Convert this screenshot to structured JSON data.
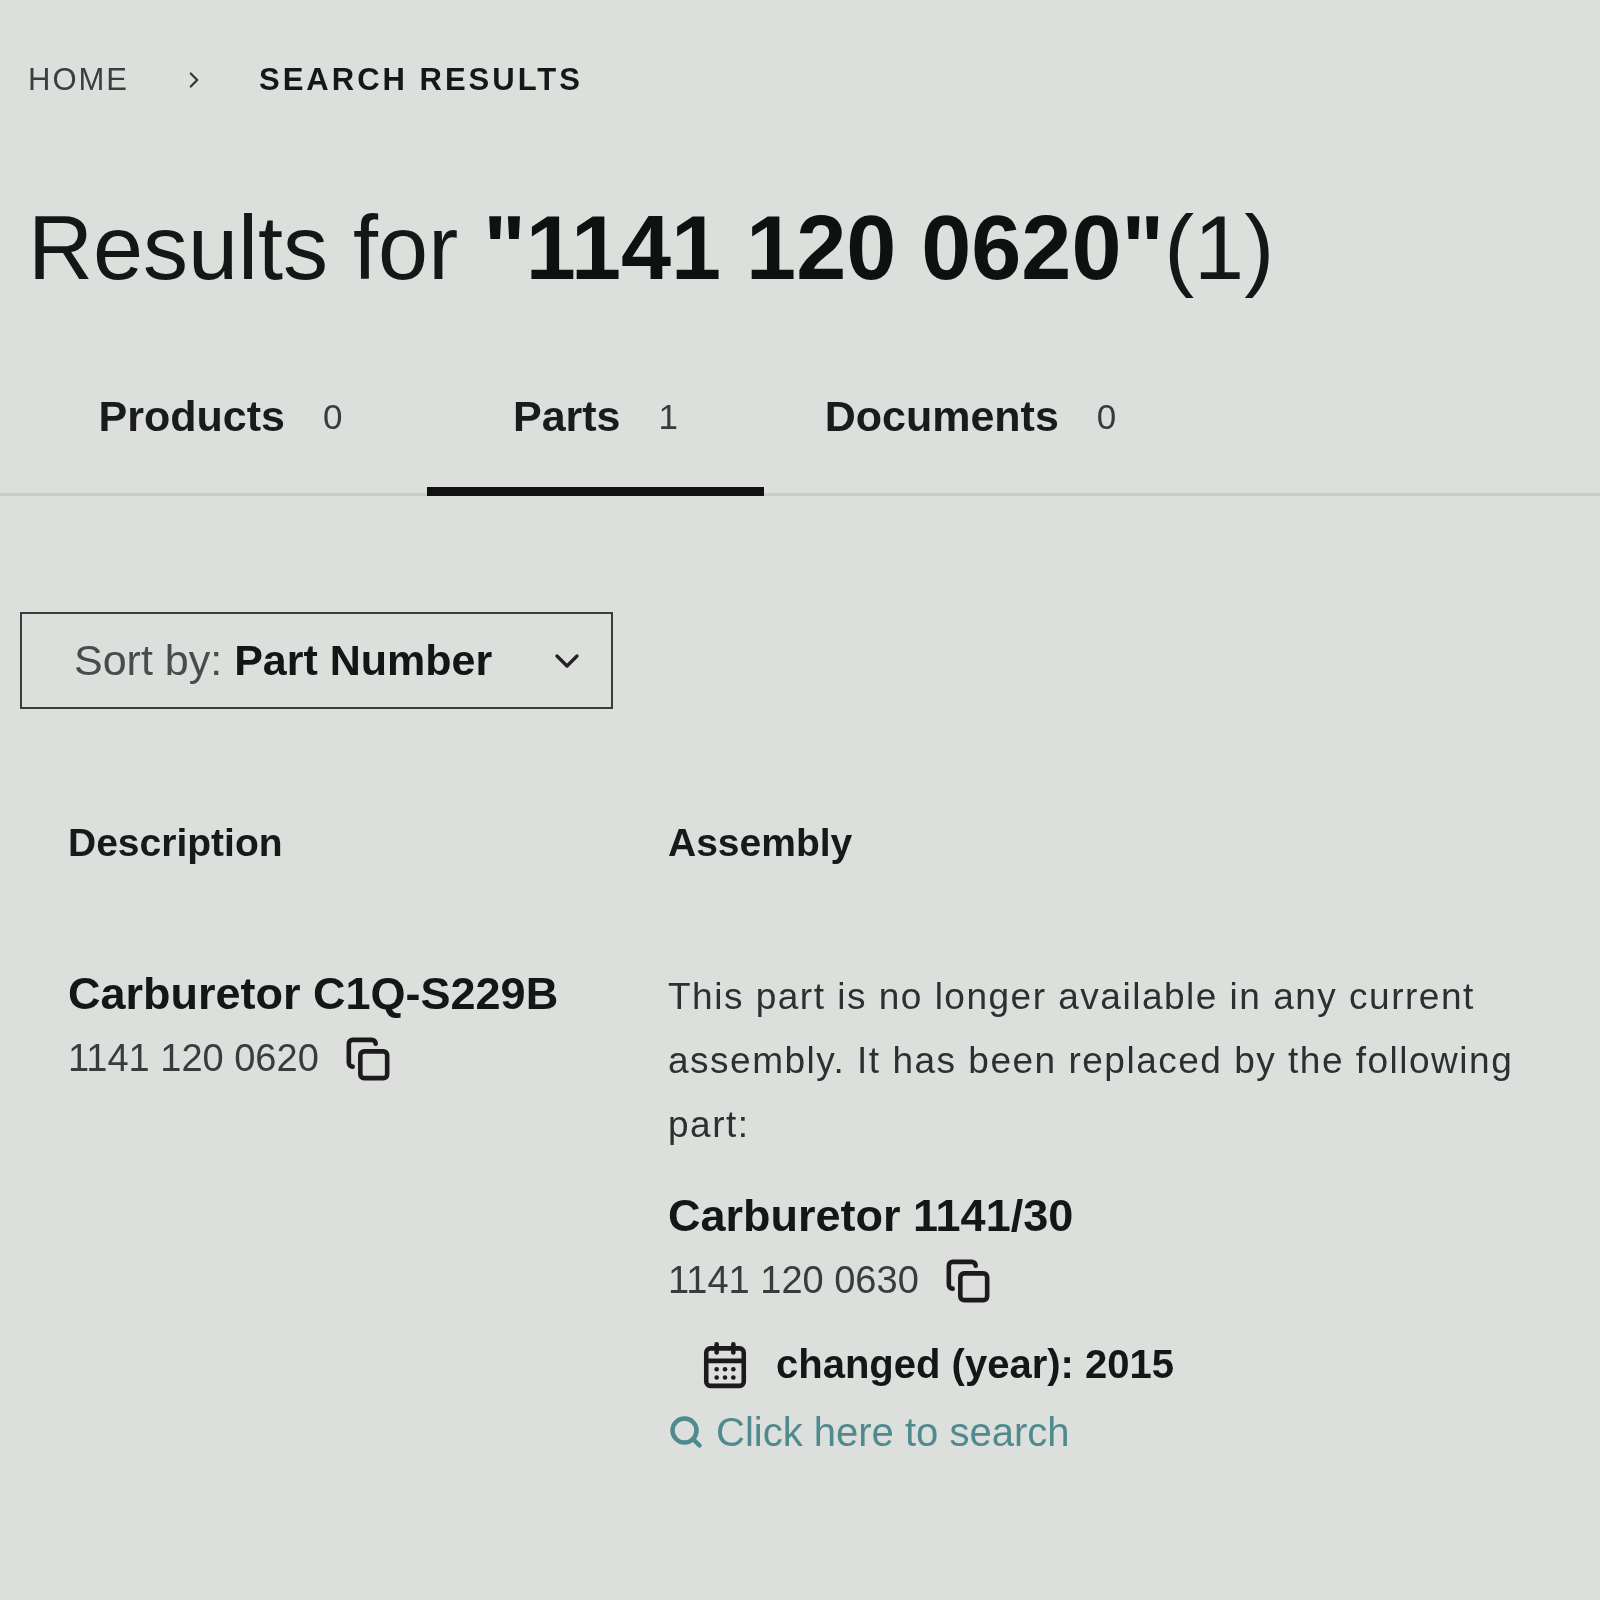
{
  "breadcrumb": [
    {
      "label": "HOME",
      "current": false
    },
    {
      "label": "SEARCH RESULTS",
      "current": true
    }
  ],
  "title": "Results for **\"1141 120 0620\"**(1)",
  "tabs": [
    {
      "label": "Products",
      "count": "0",
      "selected": false
    },
    {
      "label": "Parts",
      "count": "1",
      "selected": true
    },
    {
      "label": "Documents",
      "count": "0",
      "selected": false
    }
  ],
  "sort": {
    "label": "Sort by:",
    "value": "Part Number"
  },
  "table": {
    "columns": [
      "Description",
      "Assembly"
    ],
    "rows": [
      {
        "description": {
          "name": "Carburetor C1Q-S229B",
          "part_number": "1141 120 0620"
        },
        "assembly": {
          "message": "This part is no longer available in any current assembly. It has been replaced by the following part:",
          "replacement": {
            "name": "Carburetor 1141/30",
            "part_number": "1141 120 0630"
          },
          "changed": "changed (year): 2015",
          "search_link": "Click here to search"
        }
      }
    ]
  }
}
